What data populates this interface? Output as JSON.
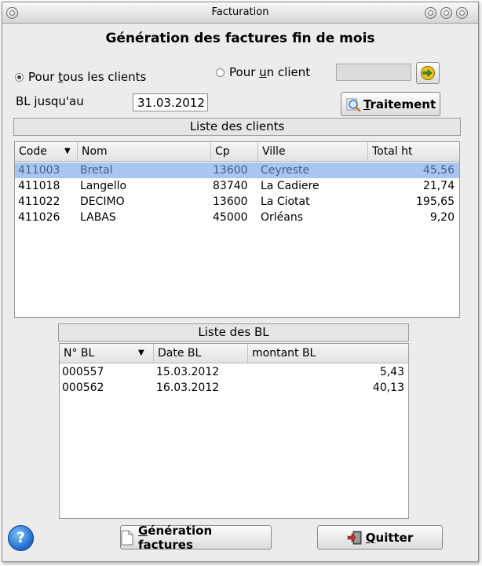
{
  "window": {
    "title": "Facturation"
  },
  "heading": "Génération des factures fin de mois",
  "options": {
    "all_clients": {
      "prefix": "Pour ",
      "mnemonic": "t",
      "suffix": "ous les clients"
    },
    "one_client": {
      "prefix": "Pour ",
      "mnemonic": "u",
      "suffix": "n client"
    },
    "selected": "all_clients"
  },
  "client_field": {
    "value": ""
  },
  "bl_until": {
    "label": "BL jusqu'au",
    "value": "31.03.2012"
  },
  "traitement_button": {
    "mnemonic": "T",
    "rest": "raitement"
  },
  "clients": {
    "section_title": "Liste des clients",
    "columns": [
      "Code",
      "Nom",
      "Cp",
      "Ville",
      "Total ht"
    ],
    "rows": [
      [
        "411003",
        "Bretal",
        "13600",
        "Ceyreste",
        "45,56"
      ],
      [
        "411018",
        "Langello",
        "83740",
        "La Cadiere",
        "21,74"
      ],
      [
        "411022",
        "DECIMO",
        "13600",
        "La Ciotat",
        "195,65"
      ],
      [
        "411026",
        "LABAS",
        "45000",
        "Orléans",
        "9,20"
      ]
    ],
    "selected_row": 0
  },
  "bl": {
    "section_title": "Liste des BL",
    "columns": [
      "N° BL",
      "Date BL",
      "montant BL"
    ],
    "rows": [
      [
        "000557",
        "15.03.2012",
        "5,43"
      ],
      [
        "000562",
        "16.03.2012",
        "40,13"
      ]
    ]
  },
  "generate_button": {
    "mnemonic": "G",
    "rest": "énération factures"
  },
  "quit_button": {
    "mnemonic": "Q",
    "rest": "uitter"
  },
  "colors": {
    "selection": "#a8c6ee",
    "window_bg": "#ececec"
  },
  "icons": [
    "help-icon",
    "document-icon",
    "exit-door-icon",
    "search-magnifier-icon",
    "arrow-go-icon"
  ]
}
